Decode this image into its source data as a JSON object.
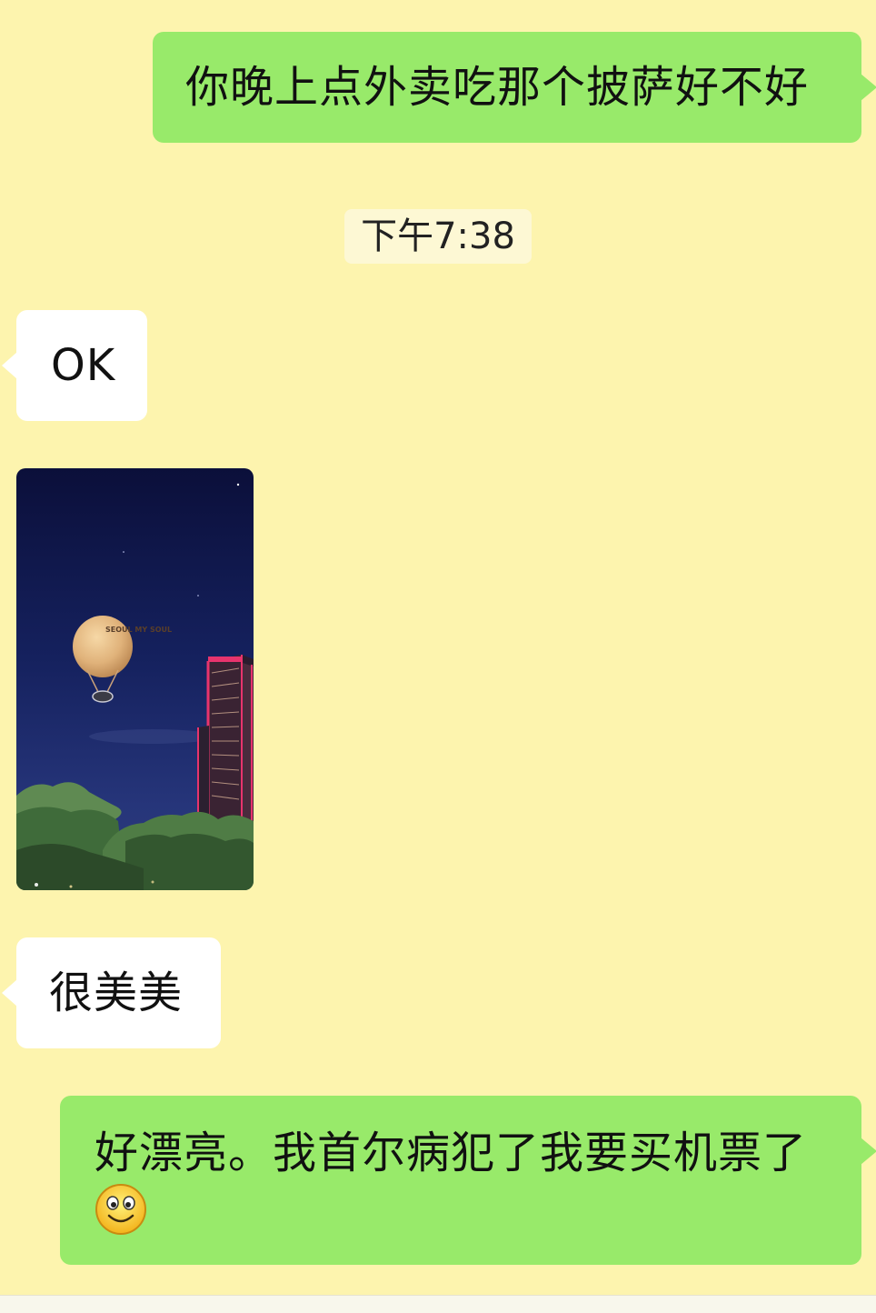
{
  "messages": [
    {
      "direction": "outgoing",
      "text": "你晚上点外卖吃那个披萨好不好"
    },
    {
      "direction": "timestamp",
      "text": "下午7:38"
    },
    {
      "direction": "incoming",
      "text": "OK"
    },
    {
      "direction": "incoming",
      "type": "photo",
      "content_icon": "hot-air-balloon-night-photo",
      "balloon_text": "SEOUL MY SOUL"
    },
    {
      "direction": "incoming",
      "text": "很美美"
    },
    {
      "direction": "outgoing",
      "text": "好漂亮。我首尔病犯了我要买机票了",
      "emoji": "smile-emoji"
    }
  ],
  "colors": {
    "background": "#fdf4ae",
    "outgoing_bubble": "#98ea6a",
    "incoming_bubble": "#ffffff",
    "timestamp_bg": "#fdf8d4"
  }
}
